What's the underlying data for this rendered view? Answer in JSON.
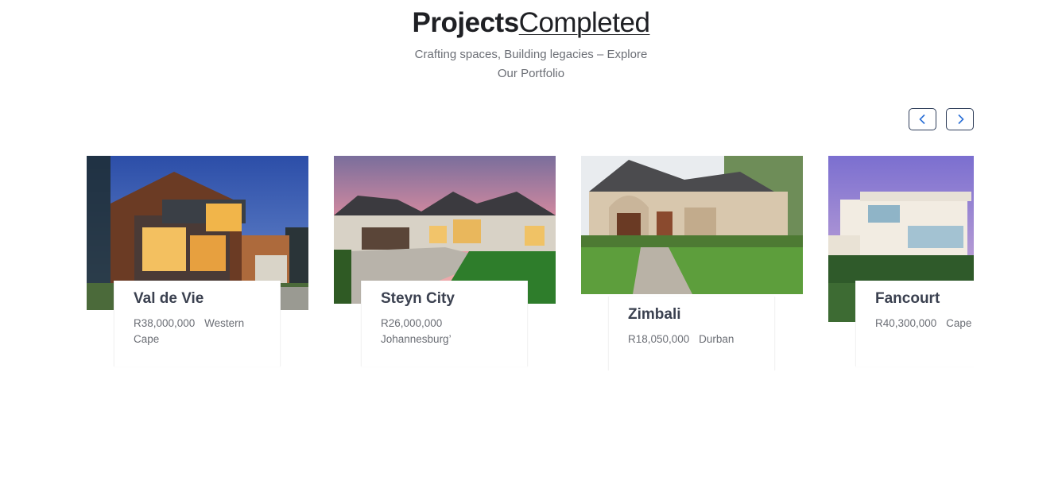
{
  "header": {
    "title_strong": "Projects",
    "title_light": "Completed",
    "subtitle": "Crafting spaces, Building legacies – Explore Our Portfolio"
  },
  "nav": {
    "prev_icon": "chevron-left-icon",
    "next_icon": "chevron-right-icon"
  },
  "projects": [
    {
      "name": "Val de Vie",
      "price": "R38,000,000",
      "location": "Western Cape"
    },
    {
      "name": "Steyn City",
      "price": "R26,000,000",
      "location": "Johannesburg’"
    },
    {
      "name": "Zimbali",
      "price": "R18,050,000",
      "location": "Durban"
    },
    {
      "name": "Fancourt",
      "price": "R40,300,000",
      "location": "Cape Town"
    }
  ]
}
